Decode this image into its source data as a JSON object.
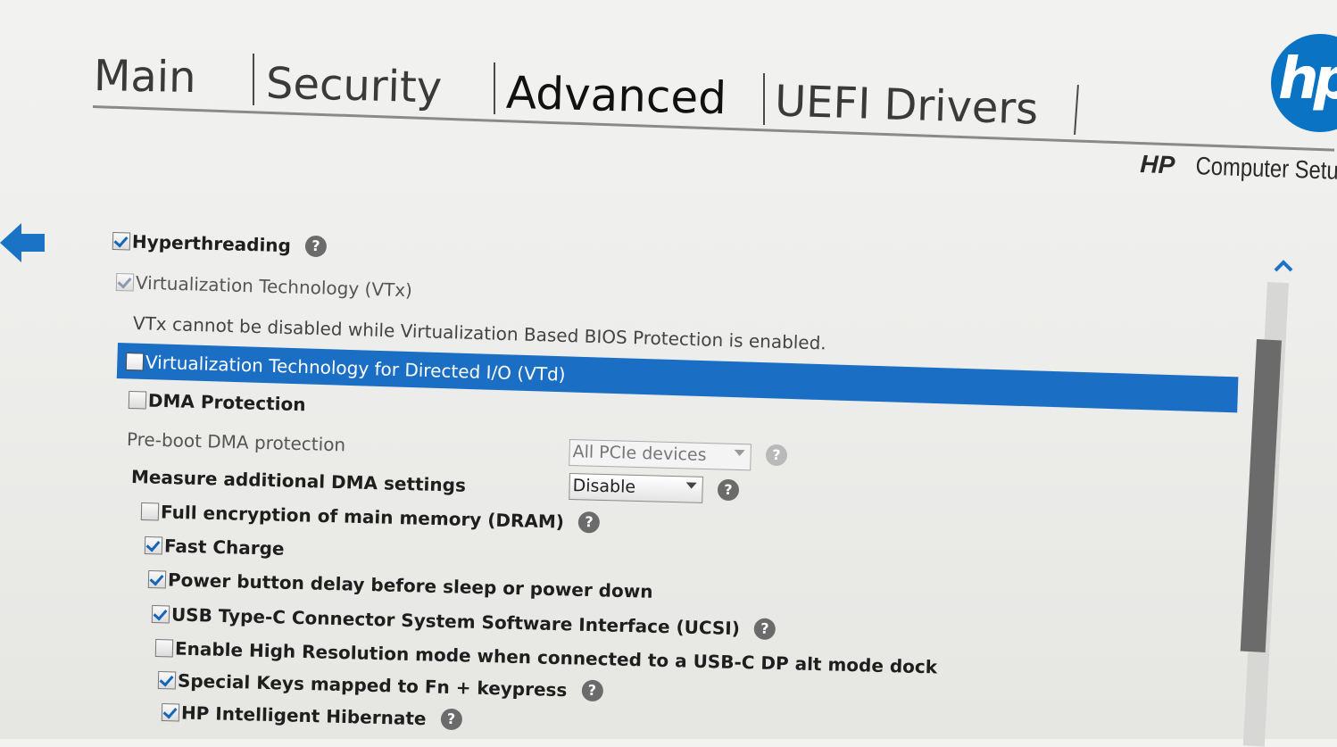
{
  "tabs": [
    {
      "label": "Main",
      "active": false
    },
    {
      "label": "Security",
      "active": false
    },
    {
      "label": "Advanced",
      "active": true
    },
    {
      "label": "UEFI Drivers",
      "active": false
    }
  ],
  "brand": {
    "logo_text": "hp",
    "title_bold": "HP",
    "title_rest": "Computer Setup",
    "logo_color": "#0a73c4"
  },
  "settings": {
    "hyperthreading": {
      "label": "Hyperthreading",
      "checked": true
    },
    "vtx": {
      "label": "Virtualization Technology (VTx)",
      "checked": true,
      "enabled": false
    },
    "vtx_note": "VTx cannot be disabled while Virtualization Based BIOS Protection is enabled.",
    "vtd": {
      "label": "Virtualization Technology for Directed I/O (VTd)",
      "checked": false,
      "selected": true
    },
    "dma_protection": {
      "label": "DMA Protection",
      "checked": false
    },
    "preboot_dma": {
      "label": "Pre-boot DMA protection",
      "value": "All PCIe devices",
      "enabled": false
    },
    "measure_dma": {
      "label": "Measure additional DMA settings",
      "value": "Disable"
    },
    "full_encryption": {
      "label": "Full encryption of main memory (DRAM)",
      "checked": false
    },
    "fast_charge": {
      "label": "Fast Charge",
      "checked": true
    },
    "power_button_delay": {
      "label": "Power button delay before sleep or power down",
      "checked": true
    },
    "ucsi": {
      "label": "USB Type-C Connector System Software Interface (UCSI)",
      "checked": true
    },
    "high_res_mode": {
      "label": "Enable High Resolution mode when connected to a USB-C DP alt mode dock",
      "checked": false
    },
    "special_keys": {
      "label": "Special Keys mapped to Fn + keypress",
      "checked": true
    },
    "intelligent_hibernate": {
      "label": "HP Intelligent Hibernate",
      "checked": true
    }
  },
  "help_glyph": "?",
  "colors": {
    "selection": "#1a6fc4",
    "checkmark": "#1566b8",
    "scrollbar_thumb": "#6b6b6b"
  },
  "icons": {
    "back": "left-arrow-icon",
    "scroll_up": "chevron-up-icon",
    "help": "question-circle-icon"
  }
}
